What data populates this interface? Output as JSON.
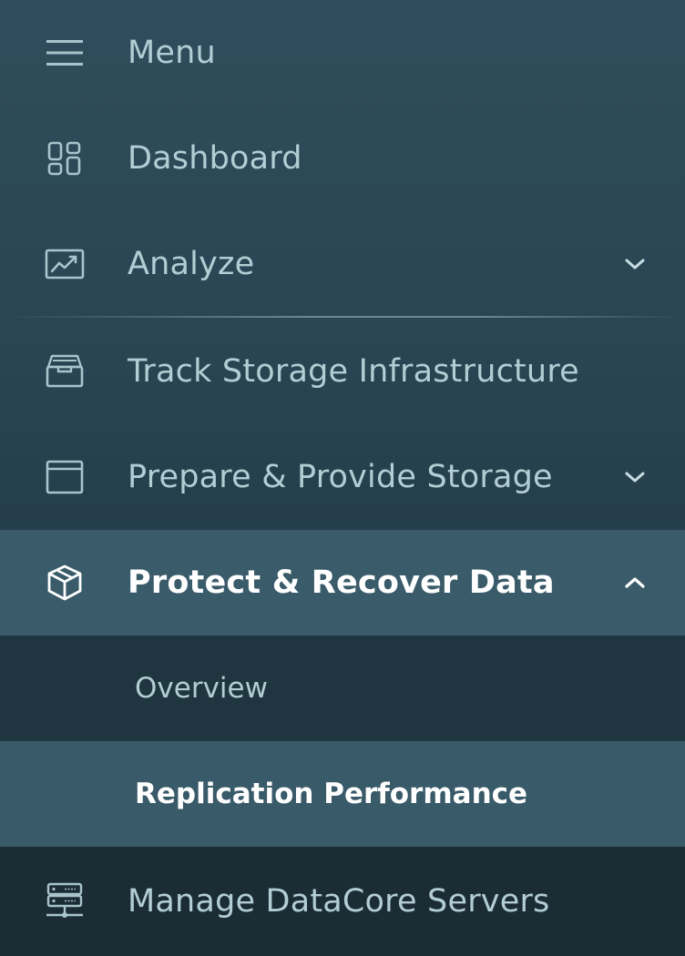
{
  "menu": {
    "title": "Menu",
    "icon": "hamburger-icon"
  },
  "nav": {
    "dashboard": {
      "label": "Dashboard",
      "icon": "dashboard-grid-icon"
    },
    "analyze": {
      "label": "Analyze",
      "icon": "chart-line-icon",
      "expanded": false
    },
    "track": {
      "label": "Track Storage Infrastructure",
      "icon": "storage-tray-icon"
    },
    "prepare": {
      "label": "Prepare & Provide Storage",
      "icon": "window-icon",
      "expanded": false
    },
    "protect": {
      "label": "Protect & Recover Data",
      "icon": "box-cube-icon",
      "expanded": true,
      "active": true,
      "children": [
        {
          "label": "Overview",
          "selected": false
        },
        {
          "label": "Replication Performance",
          "selected": true
        }
      ]
    },
    "manage": {
      "label": "Manage DataCore Servers",
      "icon": "server-icon"
    }
  },
  "colors": {
    "text": "#b3cdd4",
    "active_bg": "#3a5b6a",
    "submenu_bg": "#1f3540",
    "selected_bg": "#395a69",
    "icon": "#a9c4cc"
  }
}
